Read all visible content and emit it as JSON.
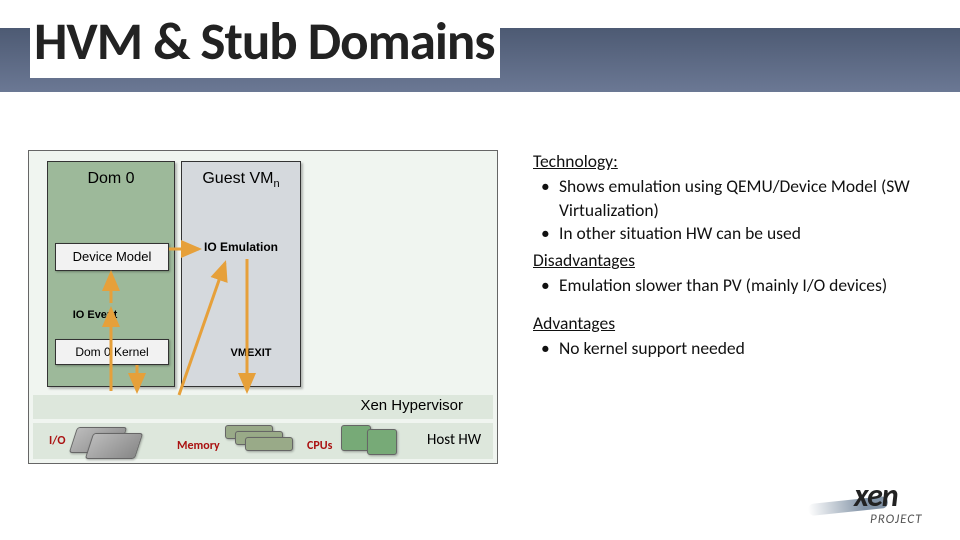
{
  "title": "HVM & Stub Domains",
  "diagram": {
    "dom0": "Dom 0",
    "guest_prefix": "Guest VM",
    "guest_sub": "n",
    "io_emulation": "IO Emulation",
    "device_model": "Device Model",
    "io_event": "IO Event",
    "dom0_kernel": "Dom 0 Kernel",
    "vmexit": "VMEXIT",
    "hypervisor": "Xen Hypervisor",
    "hw_io": "I/O",
    "hw_memory": "Memory",
    "hw_cpus": "CPUs",
    "hw_host": "Host HW"
  },
  "notes": {
    "tech_hd": "Technology:",
    "tech_items": [
      "Shows emulation using QEMU/Device Model (SW Virtualization)",
      "In other situation HW can be used"
    ],
    "dis_hd": "Disadvantages",
    "dis_items": [
      "Emulation slower than PV (mainly I/O devices)"
    ],
    "adv_hd": "Advantages",
    "adv_items": [
      "No kernel support needed"
    ]
  },
  "logo": {
    "word": "xen",
    "sub": "PROJECT"
  }
}
